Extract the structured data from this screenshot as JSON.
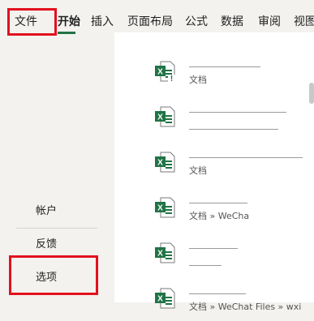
{
  "tabs": [
    {
      "id": "file",
      "label": "文件"
    },
    {
      "id": "home",
      "label": "开始"
    },
    {
      "id": "insert",
      "label": "插入"
    },
    {
      "id": "layout",
      "label": "页面布局"
    },
    {
      "id": "formulas",
      "label": "公式"
    },
    {
      "id": "data",
      "label": "数据"
    },
    {
      "id": "review",
      "label": "审阅"
    },
    {
      "id": "view",
      "label": "视图"
    }
  ],
  "sidebar": {
    "account_label": "帐户",
    "feedback_label": "反馈",
    "options_label": "选项"
  },
  "recent_files": [
    {
      "name": "",
      "path": "文档",
      "icon": "excel-file-warning-icon"
    },
    {
      "name": "",
      "path": "",
      "icon": "excel-file-icon"
    },
    {
      "name": "",
      "path": "文档",
      "icon": "excel-file-icon"
    },
    {
      "name": "",
      "path": "文档 » WeCha",
      "icon": "excel-file-icon"
    },
    {
      "name": "",
      "path": "",
      "icon": "excel-file-icon"
    },
    {
      "name": "",
      "path": "文档 » WeChat Files » wxi",
      "icon": "excel-file-icon"
    }
  ],
  "colors": {
    "highlight_box": "#e3101d",
    "excel_green": "#217346",
    "warning_green": "#107c41"
  }
}
